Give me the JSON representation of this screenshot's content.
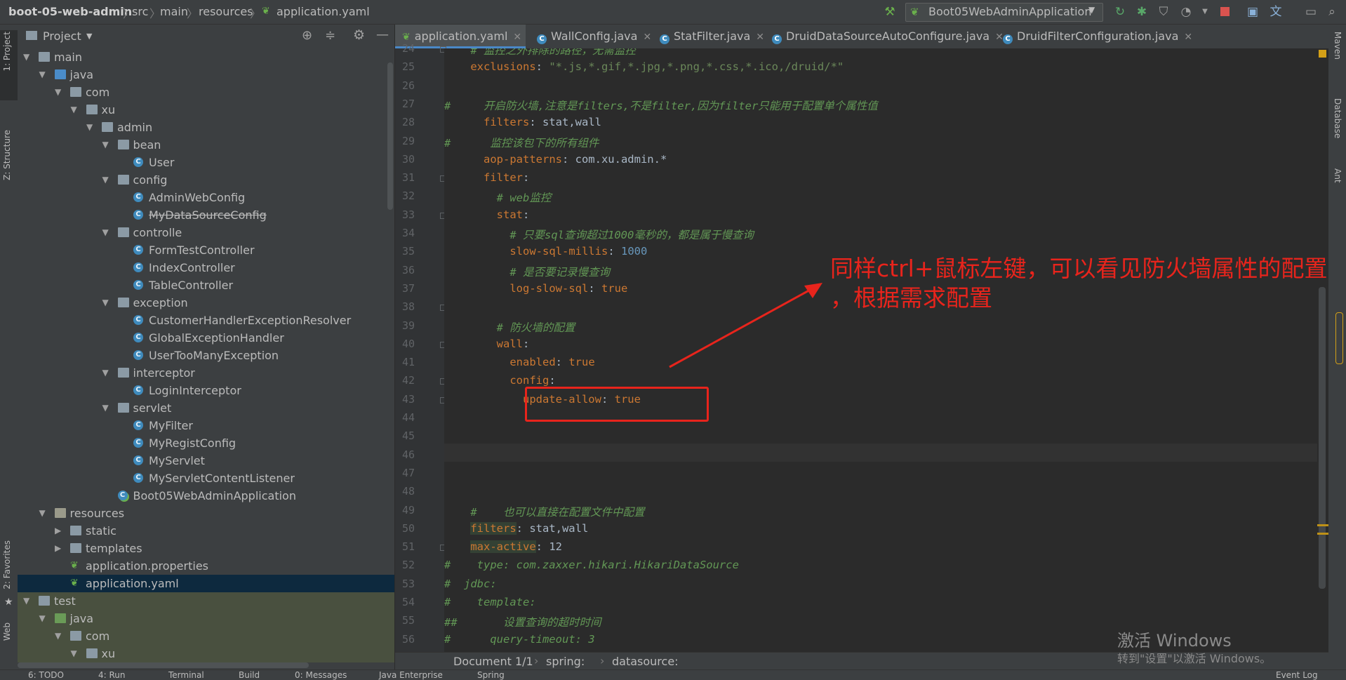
{
  "navbar": {
    "project": "boot-05-web-admin",
    "crumbs": [
      "src",
      "main",
      "resources",
      "application.yaml"
    ],
    "run_config": "Boot05WebAdminApplication"
  },
  "left_strip": {
    "tabs": [
      "1: Project",
      "Z: Structure",
      "2: Favorites",
      "Web"
    ]
  },
  "right_strip": {
    "tabs": [
      "Maven",
      "Database",
      "Ant"
    ]
  },
  "project_panel": {
    "title": "Project",
    "tree": [
      {
        "label": "main",
        "level": 2,
        "type": "folder",
        "open": true
      },
      {
        "label": "java",
        "level": 3,
        "type": "folder-blue",
        "open": true
      },
      {
        "label": "com",
        "level": 4,
        "type": "package",
        "open": true
      },
      {
        "label": "xu",
        "level": 5,
        "type": "package",
        "open": true
      },
      {
        "label": "admin",
        "level": 6,
        "type": "package",
        "open": true
      },
      {
        "label": "bean",
        "level": 7,
        "type": "package",
        "open": true
      },
      {
        "label": "User",
        "level": 8,
        "type": "class"
      },
      {
        "label": "config",
        "level": 7,
        "type": "package",
        "open": true
      },
      {
        "label": "AdminWebConfig",
        "level": 8,
        "type": "class"
      },
      {
        "label": "MyDataSourceConfig",
        "level": 8,
        "type": "class",
        "strike": true
      },
      {
        "label": "controlle",
        "level": 7,
        "type": "package",
        "open": true
      },
      {
        "label": "FormTestController",
        "level": 8,
        "type": "class"
      },
      {
        "label": "IndexController",
        "level": 8,
        "type": "class"
      },
      {
        "label": "TableController",
        "level": 8,
        "type": "class"
      },
      {
        "label": "exception",
        "level": 7,
        "type": "package",
        "open": true
      },
      {
        "label": "CustomerHandlerExceptionResolver",
        "level": 8,
        "type": "class"
      },
      {
        "label": "GlobalExceptionHandler",
        "level": 8,
        "type": "class"
      },
      {
        "label": "UserTooManyException",
        "level": 8,
        "type": "class"
      },
      {
        "label": "interceptor",
        "level": 7,
        "type": "package",
        "open": true
      },
      {
        "label": "LoginInterceptor",
        "level": 8,
        "type": "class"
      },
      {
        "label": "servlet",
        "level": 7,
        "type": "package",
        "open": true
      },
      {
        "label": "MyFilter",
        "level": 8,
        "type": "class"
      },
      {
        "label": "MyRegistConfig",
        "level": 8,
        "type": "class"
      },
      {
        "label": "MyServlet",
        "level": 8,
        "type": "class"
      },
      {
        "label": "MyServletContentListener",
        "level": 8,
        "type": "class"
      },
      {
        "label": "Boot05WebAdminApplication",
        "level": 7,
        "type": "spring-class"
      },
      {
        "label": "resources",
        "level": 3,
        "type": "folder-res",
        "open": true
      },
      {
        "label": "static",
        "level": 4,
        "type": "folder",
        "open": false
      },
      {
        "label": "templates",
        "level": 4,
        "type": "folder",
        "open": false
      },
      {
        "label": "application.properties",
        "level": 4,
        "type": "yaml"
      },
      {
        "label": "application.yaml",
        "level": 4,
        "type": "yaml",
        "selected": true
      },
      {
        "label": "test",
        "level": 2,
        "type": "folder",
        "open": true,
        "test": true
      },
      {
        "label": "java",
        "level": 3,
        "type": "folder-green",
        "open": true,
        "test": true
      },
      {
        "label": "com",
        "level": 4,
        "type": "package",
        "open": true,
        "test": true
      },
      {
        "label": "xu",
        "level": 5,
        "type": "package",
        "open": true,
        "test": true
      }
    ]
  },
  "editor_tabs": [
    {
      "label": "application.yaml",
      "active": true,
      "kind": "yaml"
    },
    {
      "label": "WallConfig.java",
      "kind": "class"
    },
    {
      "label": "StatFilter.java",
      "kind": "class"
    },
    {
      "label": "DruidDataSourceAutoConfigure.java",
      "kind": "class"
    },
    {
      "label": "DruidFilterConfiguration.java",
      "kind": "class"
    }
  ],
  "code": [
    {
      "n": "24",
      "html": "    <span class=\"c\"># 监控之外排除的路径，无需监控</span>"
    },
    {
      "n": "25",
      "html": "    <span class=\"k\">exclusions</span>: <span class=\"s\">\"*.js,*.gif,*.jpg,*.png,*.css,*.ico,/druid/*\"</span>"
    },
    {
      "n": "26",
      "html": ""
    },
    {
      "n": "27",
      "html": "<span class=\"c\">#     开启防火墙,注意是filters,不是filter,因为filter只能用于配置单个属性值</span>"
    },
    {
      "n": "28",
      "html": "      <span class=\"k\">filters</span>: stat,wall"
    },
    {
      "n": "29",
      "html": "<span class=\"c\">#      监控该包下的所有组件</span>"
    },
    {
      "n": "30",
      "html": "      <span class=\"k\">aop-patterns</span>: com.xu.admin.*"
    },
    {
      "n": "31",
      "html": "      <span class=\"k\">filter</span>:"
    },
    {
      "n": "32",
      "html": "        <span class=\"c\"># web监控</span>"
    },
    {
      "n": "33",
      "html": "        <span class=\"k\">stat</span>:"
    },
    {
      "n": "34",
      "html": "          <span class=\"c\"># 只要sql查询超过1000毫秒的，都是属于慢查询</span>"
    },
    {
      "n": "35",
      "html": "          <span class=\"k\">slow-sql-millis</span>: <span class=\"n\">1000</span>"
    },
    {
      "n": "36",
      "html": "          <span class=\"c\"># 是否要记录慢查询</span>"
    },
    {
      "n": "37",
      "html": "          <span class=\"k\">log-slow-sql</span>: <span class=\"k\">true</span>"
    },
    {
      "n": "38",
      "html": ""
    },
    {
      "n": "39",
      "html": "        <span class=\"c\"># 防火墙的配置</span>"
    },
    {
      "n": "40",
      "html": "        <span class=\"k\">wall</span>:"
    },
    {
      "n": "41",
      "html": "          <span class=\"k\">enabled</span>: <span class=\"k\">true</span>"
    },
    {
      "n": "42",
      "html": "          <span class=\"k\">config</span>:"
    },
    {
      "n": "43",
      "html": "            <span class=\"k\">update-allow</span>: <span class=\"k\">true</span>"
    },
    {
      "n": "44",
      "html": ""
    },
    {
      "n": "45",
      "html": ""
    },
    {
      "n": "46",
      "html": ""
    },
    {
      "n": "47",
      "html": ""
    },
    {
      "n": "48",
      "html": ""
    },
    {
      "n": "49",
      "html": "    <span class=\"c\">#    也可以直接在配置文件中配置</span>"
    },
    {
      "n": "50",
      "html": "    <span class=\"k hl\">filters</span>: stat,wall"
    },
    {
      "n": "51",
      "html": "    <span class=\"k hl\">max-active</span>: 12"
    },
    {
      "n": "52",
      "html": "<span class=\"c\">#    type: com.zaxxer.hikari.HikariDataSource</span>"
    },
    {
      "n": "53",
      "html": "<span class=\"c\">#  jdbc:</span>"
    },
    {
      "n": "54",
      "html": "<span class=\"c\">#    template:</span>"
    },
    {
      "n": "55",
      "html": "<span class=\"c\">##       设置查询的超时时间</span>"
    },
    {
      "n": "56",
      "html": "<span class=\"c\">#      query-timeout: 3</span>"
    }
  ],
  "breadcrumb_bottom": [
    "Document 1/1",
    "spring:",
    "datasource:"
  ],
  "bottom_tools": [
    "6: TODO",
    "4: Run",
    "Terminal",
    "Build",
    "0: Messages",
    "Java Enterprise",
    "Spring",
    "Event Log"
  ],
  "annotation": {
    "line1": "同样ctrl+鼠标左键，可以看见防火墙属性的配置",
    "line2": "，根据需求配置"
  },
  "watermark": {
    "line1": "激活 Windows",
    "line2": "转到\"设置\"以激活 Windows。"
  },
  "colors": {
    "accent_red": "#e8241c",
    "keyword": "#cc7832",
    "string": "#6a8759",
    "comment": "#629755",
    "number": "#6897bb"
  }
}
